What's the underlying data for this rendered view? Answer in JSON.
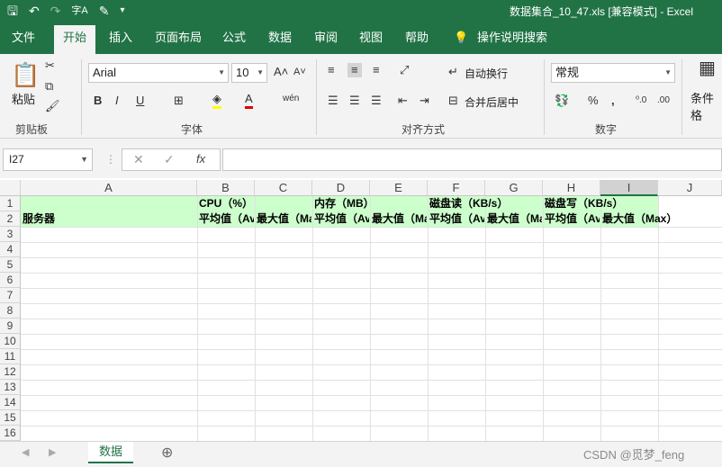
{
  "title": {
    "text": "数据集合_10_47.xls  [兼容模式]  -  Excel"
  },
  "tabs": [
    "文件",
    "开始",
    "插入",
    "页面布局",
    "公式",
    "数据",
    "审阅",
    "视图",
    "帮助",
    "操作说明搜索"
  ],
  "ribbon": {
    "paste_label": "粘贴",
    "clipboard_label": "剪贴板",
    "font_name": "Arial",
    "font_size": "10",
    "font_group_label": "字体",
    "wrap_text": "自动换行",
    "merge_center": "合并后居中",
    "align_group_label": "对齐方式",
    "number_format": "常规",
    "number_group_label": "数字",
    "conditional_label": "条件格"
  },
  "formula_bar": {
    "name_box": "I27",
    "formula": ""
  },
  "grid": {
    "columns": [
      "A",
      "B",
      "C",
      "D",
      "E",
      "F",
      "G",
      "H",
      "I",
      "J"
    ],
    "rows": [
      "1",
      "2",
      "3",
      "4",
      "5",
      "6",
      "7",
      "8",
      "9",
      "10",
      "11",
      "12",
      "13",
      "14",
      "15",
      "16"
    ],
    "row1": {
      "B": "CPU（%）",
      "D": "内存（MB）",
      "F": "磁盘读（KB/s）",
      "H": "磁盘写（KB/s）"
    },
    "row2": {
      "A": "服务器",
      "B": "平均值（Avg）",
      "C": "最大值（Max）",
      "D": "平均值（Avg）",
      "E": "最大值（Max）",
      "F": "平均值（Avg）",
      "G": "最大值（Max）",
      "H": "平均值（Avg）",
      "I": "最大值（Max）"
    }
  },
  "sheet": {
    "tab": "数据"
  },
  "watermark": "CSDN @觅梦_feng"
}
